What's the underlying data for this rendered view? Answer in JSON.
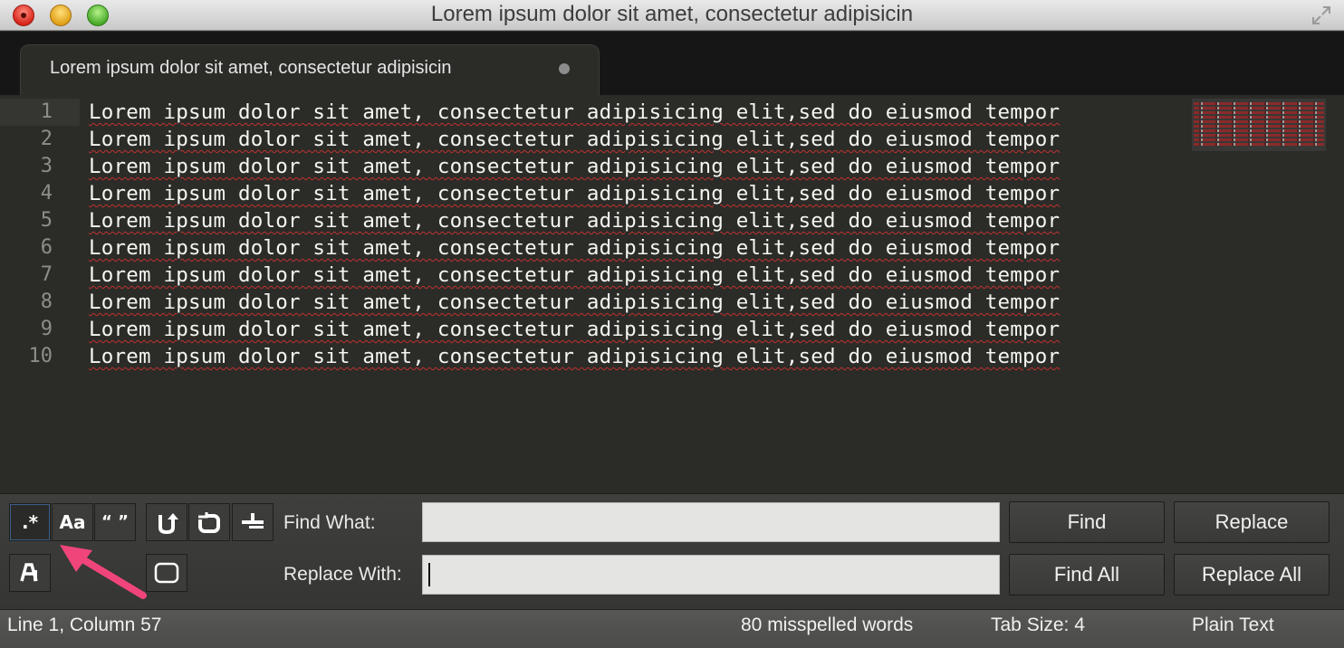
{
  "window": {
    "title": "Lorem ipsum dolor sit amet, consectetur adipisicin",
    "colors": {
      "close": "#d8261b",
      "minimize": "#e1a019",
      "maximize": "#4aaa2a"
    }
  },
  "tab": {
    "label": "Lorem ipsum dolor sit amet, consectetur adipisicin",
    "modified": true
  },
  "editor": {
    "lines": [
      {
        "num": "1",
        "text": "Lorem ipsum dolor sit amet, consectetur adipisicing elit,sed do eiusmod tempor"
      },
      {
        "num": "2",
        "text": "Lorem ipsum dolor sit amet, consectetur adipisicing elit,sed do eiusmod tempor"
      },
      {
        "num": "3",
        "text": "Lorem ipsum dolor sit amet, consectetur adipisicing elit,sed do eiusmod tempor"
      },
      {
        "num": "4",
        "text": "Lorem ipsum dolor sit amet, consectetur adipisicing elit,sed do eiusmod tempor"
      },
      {
        "num": "5",
        "text": "Lorem ipsum dolor sit amet, consectetur adipisicing elit,sed do eiusmod tempor"
      },
      {
        "num": "6",
        "text": "Lorem ipsum dolor sit amet, consectetur adipisicing elit,sed do eiusmod tempor"
      },
      {
        "num": "7",
        "text": "Lorem ipsum dolor sit amet, consectetur adipisicing elit,sed do eiusmod tempor"
      },
      {
        "num": "8",
        "text": "Lorem ipsum dolor sit amet, consectetur adipisicing elit,sed do eiusmod tempor"
      },
      {
        "num": "9",
        "text": "Lorem ipsum dolor sit amet, consectetur adipisicing elit,sed do eiusmod tempor"
      },
      {
        "num": "10",
        "text": "Lorem ipsum dolor sit amet, consectetur adipisicing elit,sed do eiusmod tempor"
      }
    ]
  },
  "find_panel": {
    "options": {
      "regex": ".*",
      "case_sensitive": "Aa",
      "whole_word": "“ ”"
    },
    "find_label": "Find What:",
    "find_value": "",
    "replace_label": "Replace With:",
    "replace_value": "",
    "buttons": {
      "find": "Find",
      "replace": "Replace",
      "find_all": "Find All",
      "replace_all": "Replace All"
    }
  },
  "status": {
    "position": "Line 1, Column 57",
    "spelling": "80 misspelled words",
    "tab_size": "Tab Size: 4",
    "syntax": "Plain Text"
  },
  "annotation_color": "#f0457a"
}
